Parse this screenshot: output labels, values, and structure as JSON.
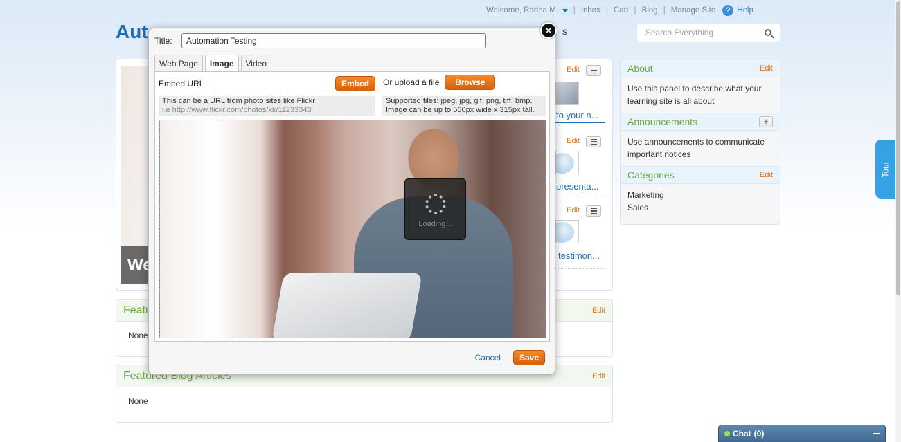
{
  "header": {
    "welcome": "Welcome, Radha M",
    "links": [
      "Inbox",
      "Cart",
      "Blog",
      "Manage Site"
    ],
    "help": "Help",
    "site_title": "Auto",
    "nav_fragments": [
      "s"
    ],
    "search_placeholder": "Search Everything"
  },
  "main": {
    "hero_caption": "We",
    "side_items": [
      {
        "edit": "Edit",
        "link": "to your n..."
      },
      {
        "edit": "Edit",
        "link": "presenta..."
      },
      {
        "edit": "Edit",
        "link": "testimon..."
      }
    ]
  },
  "featured": [
    {
      "title": "Featur",
      "edit": "Edit",
      "body": "None"
    },
    {
      "title": "Featured Blog Articles",
      "edit": "Edit",
      "body": "None"
    }
  ],
  "sidebar": {
    "about": {
      "title": "About",
      "edit": "Edit",
      "body": "Use this panel to describe what your learning site is all about"
    },
    "announcements": {
      "title": "Announcements",
      "add": "+",
      "body": "Use announcements to communicate important notices"
    },
    "categories": {
      "title": "Categories",
      "edit": "Edit",
      "items": [
        "Marketing",
        "Sales"
      ]
    }
  },
  "tour": "Tour",
  "chat": {
    "label": "Chat",
    "count": "(0)"
  },
  "dialog": {
    "close": "×",
    "title_label": "Title:",
    "title_value": "Automation Testing",
    "tabs": [
      "Web Page",
      "Image",
      "Video"
    ],
    "active_tab": "Image",
    "embed_label": "Embed URL",
    "embed_value": "",
    "embed_button": "Embed",
    "upload_label": "Or upload a file",
    "browse_button": "Browse",
    "hint_left_1": "This can be a URL from photo sites like Flickr",
    "hint_left_2": "i.e http://www.flickr.com/photos/kk/11233343",
    "hint_right_1": "Supported files: jpeg, jpg, gif, png, tiff, bmp.",
    "hint_right_2": "Image can be up to 560px wide x 315px tall.",
    "loading": "Loading...",
    "cancel": "Cancel",
    "save": "Save"
  }
}
